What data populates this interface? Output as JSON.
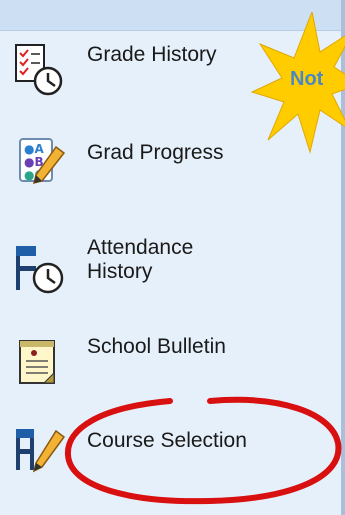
{
  "menu": {
    "items": [
      {
        "label": "Grade History",
        "icon": "grade-history-icon"
      },
      {
        "label": "Grad Progress",
        "icon": "grad-progress-icon"
      },
      {
        "label": "Attendance\nHistory",
        "icon": "attendance-history-icon"
      },
      {
        "label": "School Bulletin",
        "icon": "school-bulletin-icon"
      },
      {
        "label": "Course Selection",
        "icon": "course-selection-icon"
      }
    ]
  },
  "burst": {
    "text": "Not",
    "color": "#ffcc00"
  },
  "annotation": {
    "color": "#d81010"
  },
  "colors": {
    "panel": "#e6f0fa",
    "header": "#cddff3",
    "accent": "#1f5fa8"
  }
}
